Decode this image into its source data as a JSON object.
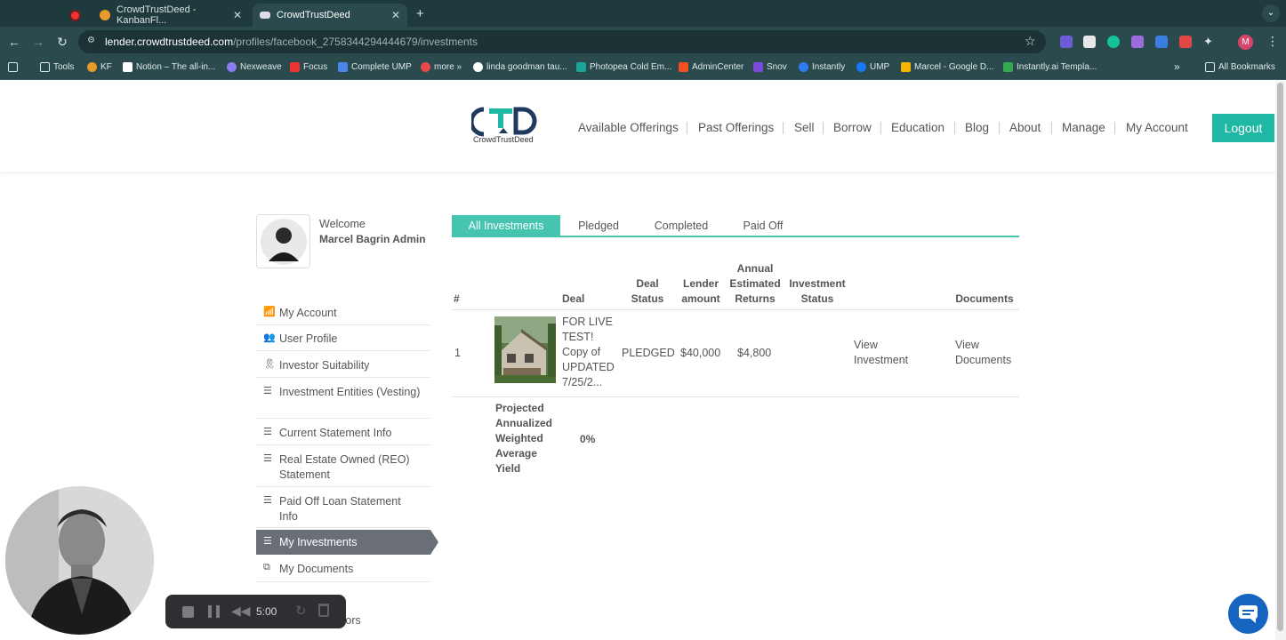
{
  "browser": {
    "tabs": [
      {
        "title": ""
      },
      {
        "title": "CrowdTrustDeed - KanbanFl..."
      },
      {
        "title": "CrowdTrustDeed"
      }
    ],
    "url_host": "lender.crowdtrustdeed.com",
    "url_path": "/profiles/facebook_2758344294444679/investments",
    "bookmarks": [
      "Tools",
      "KF",
      "Notion – The all-in...",
      "Nexweave",
      "Focus",
      "Complete UMP",
      "more »",
      "linda goodman tau...",
      "Photopea Cold Em...",
      "AdminCenter",
      "Snov",
      "Instantly",
      "UMP",
      "Marcel - Google D...",
      "Instantly.ai Templa..."
    ],
    "all_bookmarks": "All Bookmarks",
    "overflow": "»",
    "profile_initial": "M"
  },
  "site": {
    "logo_text": "CrowdTrustDeed",
    "nav": [
      "Available Offerings",
      "Past Offerings",
      "Sell",
      "Borrow",
      "Education",
      "Blog",
      "About",
      "Manage",
      "My Account"
    ],
    "logout": "Logout",
    "accent": "#1fb8a4"
  },
  "profile": {
    "welcome": "Welcome",
    "name": "Marcel Bagrin Admin"
  },
  "sidebar": {
    "items": [
      {
        "label": "My Account",
        "icon": "bar-chart-icon"
      },
      {
        "label": "User Profile",
        "icon": "user-group-icon"
      },
      {
        "label": "Investor Suitability",
        "icon": "ribbon-icon"
      },
      {
        "label": "Investment Entities (Vesting)",
        "icon": "list-icon"
      },
      {
        "label": "Current Statement Info",
        "icon": "list-icon"
      },
      {
        "label": "Real Estate Owned (REO) Statement",
        "icon": "list-icon"
      },
      {
        "label": "Paid Off Loan Statement Info",
        "icon": "list-icon"
      },
      {
        "label": "My Investments",
        "icon": "list-icon"
      },
      {
        "label": "My Documents",
        "icon": "documents-icon"
      },
      {
        "label": "...ors",
        "icon": ""
      }
    ]
  },
  "tabs": [
    "All Investments",
    "Pledged",
    "Completed",
    "Paid Off"
  ],
  "table": {
    "headers": {
      "num": "#",
      "deal": "Deal",
      "deal_status": "Deal Status",
      "lender_amount": "Lender amount",
      "annual_returns": "Annual Estimated Returns",
      "investment_status": "Investment Status",
      "documents": "Documents"
    },
    "rows": [
      {
        "num": "1",
        "deal": "FOR LIVE TEST! Copy of UPDATED 7/25/2...",
        "deal_status": "PLEDGED",
        "lender_amount": "$40,000",
        "annual_returns": "$4,800",
        "investment_status": "",
        "view_investment": "View Investment",
        "view_documents": "View Documents"
      }
    ],
    "summary_label": "Projected Annualized Weighted Average Yield",
    "summary_value": "0%"
  },
  "recorder": {
    "time": "5:00"
  }
}
